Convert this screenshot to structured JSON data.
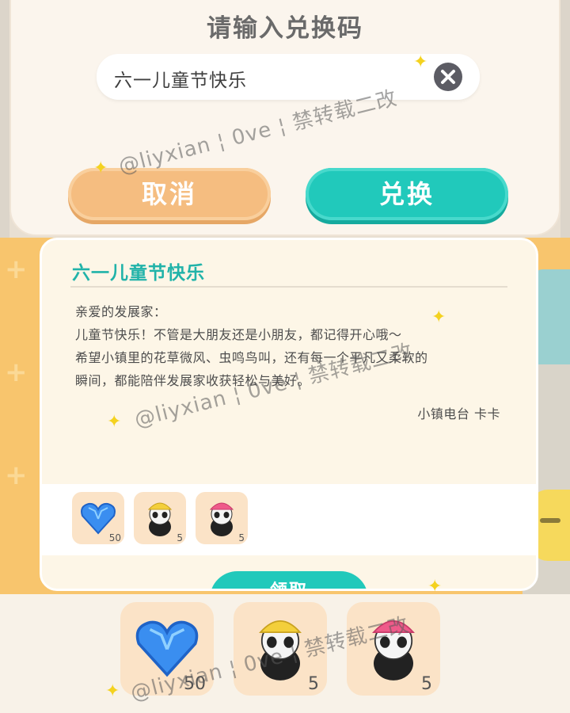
{
  "redeem_dialog": {
    "title": "请输入兑换码",
    "code_value": "六一儿童节快乐",
    "cancel_label": "取消",
    "exchange_label": "兑换"
  },
  "mail": {
    "title": "六一儿童节快乐",
    "greeting": "亲爱的发展家：",
    "lines": [
      "儿童节快乐！不管是大朋友还是小朋友，都记得开心哦～",
      "希望小镇里的花草微风、虫鸣鸟叫，还有每一个平凡又柔软的",
      "瞬间，都能陪伴发展家收获轻松与美好。"
    ],
    "signature": "小镇电台 卡卡",
    "rewards": [
      {
        "icon": "blue-heart-gem-icon",
        "count": "50"
      },
      {
        "icon": "panda-yellow-hat-icon",
        "count": "5"
      },
      {
        "icon": "panda-pink-hat-icon",
        "count": "5"
      }
    ],
    "claim_label": "领取"
  },
  "preview_rewards": [
    {
      "icon": "blue-heart-gem-icon",
      "count": "50"
    },
    {
      "icon": "panda-yellow-hat-icon",
      "count": "5"
    },
    {
      "icon": "panda-pink-hat-icon",
      "count": "5"
    }
  ],
  "watermark": "@liyxian ¦ 0ve ¦ 禁转载二改",
  "colors": {
    "teal": "#21c9bb",
    "orange": "#f5bd80",
    "title_teal": "#21b3a9",
    "background_orange": "#f8c56d"
  }
}
